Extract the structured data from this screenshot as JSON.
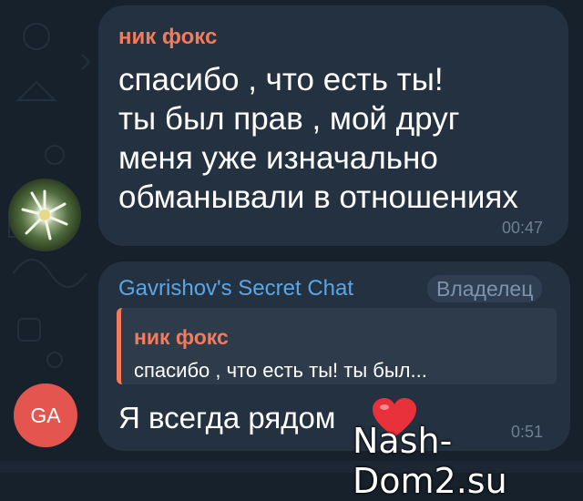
{
  "messages": [
    {
      "sender": "ник фокс",
      "lines": [
        "спасибо , что есть ты!",
        "ты был прав , мой друг",
        "меня уже изначально",
        "обманывали в отношениях"
      ],
      "time": "00:47",
      "avatar_icon": "flower-photo-avatar"
    },
    {
      "sender": "Gavrishov's Secret Chat",
      "badge": "Владелец",
      "reply": {
        "sender": "ник фокс",
        "text": "спасибо , что есть ты!  ты был..."
      },
      "text": "Я всегда рядом",
      "emoji": "heart-emoji",
      "time": "0:51",
      "avatar_initials": "GA"
    }
  ],
  "watermark": "Nash-Dom2.su",
  "colors": {
    "background": "#17212b",
    "bubble": "#243140",
    "sender_orange": "#f47a5c",
    "sender_blue": "#5aa7e8",
    "avatar_red": "#e5554f"
  }
}
